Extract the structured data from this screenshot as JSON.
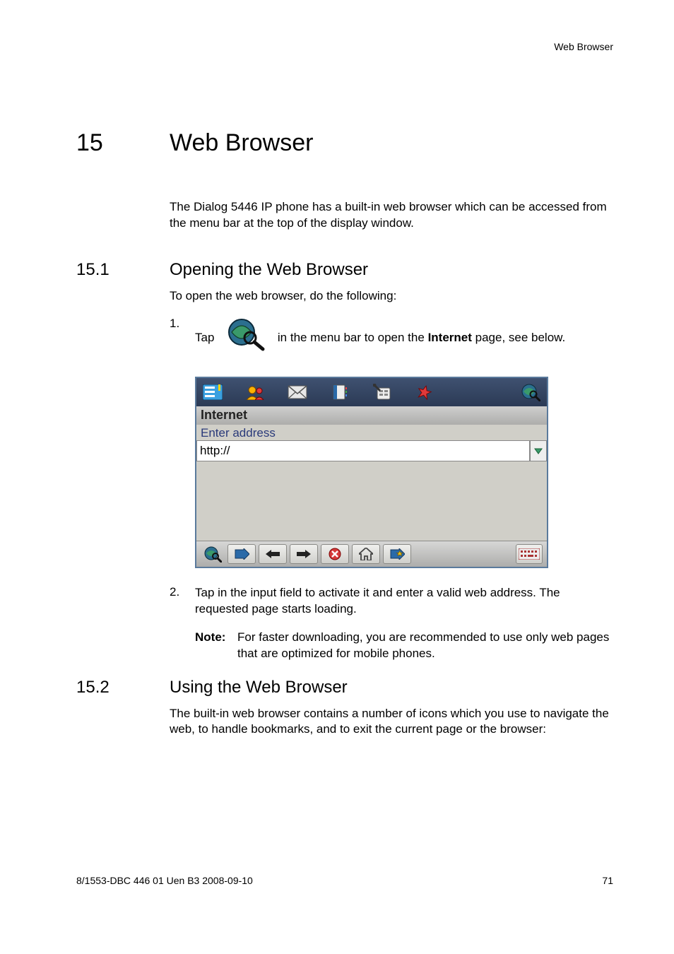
{
  "header": {
    "running": "Web Browser"
  },
  "chapter": {
    "num": "15",
    "title": "Web Browser"
  },
  "intro": "The Dialog 5446 IP phone has a built-in web browser which can be accessed from the menu bar at the top of the display window.",
  "section1": {
    "num": "15.1",
    "title": "Opening the Web Browser",
    "lead": "To open the web browser, do the following:",
    "step1_prefix": "Tap",
    "step1_mid": "in the menu bar to open the",
    "step1_bold": " Internet ",
    "step1_suffix": "page, see below.",
    "step2_text": "Tap in the input field to activate it and enter a valid web address. The requested page starts loading.",
    "note_label": "Note:",
    "note_text": "For faster downloading, you are recommended to use only web pages that are optimized for mobile phones."
  },
  "section2": {
    "num": "15.2",
    "title": "Using the Web Browser",
    "body": "The built-in web browser contains a number of icons which you use to navigate the web, to handle bookmarks, and to exit the current page or the browser:"
  },
  "screenshot": {
    "title": "Internet",
    "enter_address_label": "Enter address",
    "address_value": "http://"
  },
  "footer": {
    "left": "8/1553-DBC 446 01 Uen B3  2008-09-10",
    "right": "71"
  }
}
